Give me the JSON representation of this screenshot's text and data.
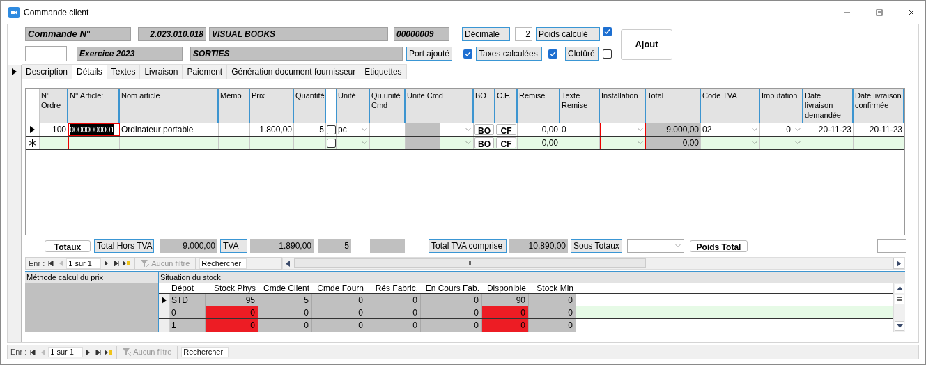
{
  "window": {
    "title": "Commande client"
  },
  "header": {
    "order_label": "Commande N°",
    "order_number": "2.023.010.018",
    "customer": "VISUAL BOOKS",
    "customer_code": "00000009",
    "decimals_label": "Décimale",
    "decimals": "2",
    "weight_calc_label": "Poids calculé",
    "weight_calc": true,
    "add_button": "Ajout",
    "year": "Exercice 2023",
    "movement": "SORTIES",
    "shipping_label": "Port ajouté",
    "shipping": true,
    "taxes_label": "Taxes calculées",
    "taxes": true,
    "closed_label": "Clotûré",
    "closed": false
  },
  "tabs": [
    {
      "label": "Description",
      "selected": false
    },
    {
      "label": "Détails",
      "selected": true
    },
    {
      "label": "Textes",
      "selected": false
    },
    {
      "label": "Livraison",
      "selected": false
    },
    {
      "label": "Paiement",
      "selected": false
    },
    {
      "label": "Génération document fournisseur",
      "selected": false
    },
    {
      "label": "Etiquettes",
      "selected": false
    }
  ],
  "grid": {
    "columns": [
      "N° Ordre",
      "N° Article:",
      "Nom article",
      "Mémo",
      "Prix",
      "Quantité",
      "Unité",
      "Qu.unité Cmd",
      "Unite Cmd",
      "BO",
      "C.F.",
      "Remise",
      "Texte Remise",
      "Installation",
      "Total",
      "Code TVA",
      "Imputation",
      "Date livraison demandée",
      "Date livraison confirmée"
    ],
    "rows": [
      {
        "kind": "current",
        "ordre": "100",
        "article": "00000000001",
        "nom": "Ordinateur portable",
        "prix": "1.800,00",
        "quantite": "5",
        "checked": false,
        "unite": "pc",
        "bo": "BO",
        "cf": "CF",
        "remise": "0,00",
        "texte_remise": "0",
        "total": "9.000,00",
        "code_tva": "02",
        "imputation": "0",
        "date_demandee": "20-11-23",
        "date_confirmee": "20-11-23"
      },
      {
        "kind": "new",
        "checked": false,
        "bo": "BO",
        "cf": "CF",
        "remise": "0,00",
        "total": "0,00"
      }
    ]
  },
  "totals": {
    "button": "Totaux",
    "net_label": "Total Hors TVA",
    "net": "9.000,00",
    "vat_label": "TVA",
    "vat": "1.890,00",
    "quantity": "5",
    "gross_label": "Total TVA comprise",
    "gross": "10.890,00",
    "subtotals_label": "Sous Totaux",
    "weight_button": "Poids Total"
  },
  "subform_navigation": {
    "label": "Enr :",
    "position": "1 sur 1",
    "filter": "Aucun filtre",
    "search": "Rechercher"
  },
  "stock": {
    "price_method_title": "Méthode calcul du prix",
    "title": "Situation du stock",
    "columns": [
      "Dépot",
      "Stock Phys",
      "Cmde Client",
      "Cmde Fourn",
      "Rés Fabric.",
      "En Cours Fab.",
      "Disponible",
      "Stock Min"
    ],
    "rows": [
      {
        "selected": true,
        "highlight": false,
        "cells": [
          {
            "value": "STD",
            "alert": false
          },
          {
            "value": "95",
            "alert": false
          },
          {
            "value": "5",
            "alert": false
          },
          {
            "value": "0",
            "alert": false
          },
          {
            "value": "0",
            "alert": false
          },
          {
            "value": "0",
            "alert": false
          },
          {
            "value": "90",
            "alert": false
          },
          {
            "value": "0",
            "alert": false
          }
        ]
      },
      {
        "selected": false,
        "highlight": true,
        "cells": [
          {
            "value": "0",
            "alert": false
          },
          {
            "value": "0",
            "alert": true
          },
          {
            "value": "0",
            "alert": false
          },
          {
            "value": "0",
            "alert": false
          },
          {
            "value": "0",
            "alert": false
          },
          {
            "value": "0",
            "alert": false
          },
          {
            "value": "0",
            "alert": true
          },
          {
            "value": "0",
            "alert": false
          }
        ]
      },
      {
        "selected": false,
        "highlight": false,
        "cells": [
          {
            "value": "1",
            "alert": false
          },
          {
            "value": "0",
            "alert": true
          },
          {
            "value": "0",
            "alert": false
          },
          {
            "value": "0",
            "alert": false
          },
          {
            "value": "0",
            "alert": false
          },
          {
            "value": "0",
            "alert": false
          },
          {
            "value": "0",
            "alert": true
          },
          {
            "value": "0",
            "alert": false
          }
        ]
      }
    ]
  },
  "form_navigation": {
    "label": "Enr :",
    "position": "1 sur 1",
    "filter": "Aucun filtre",
    "search": "Rechercher"
  }
}
